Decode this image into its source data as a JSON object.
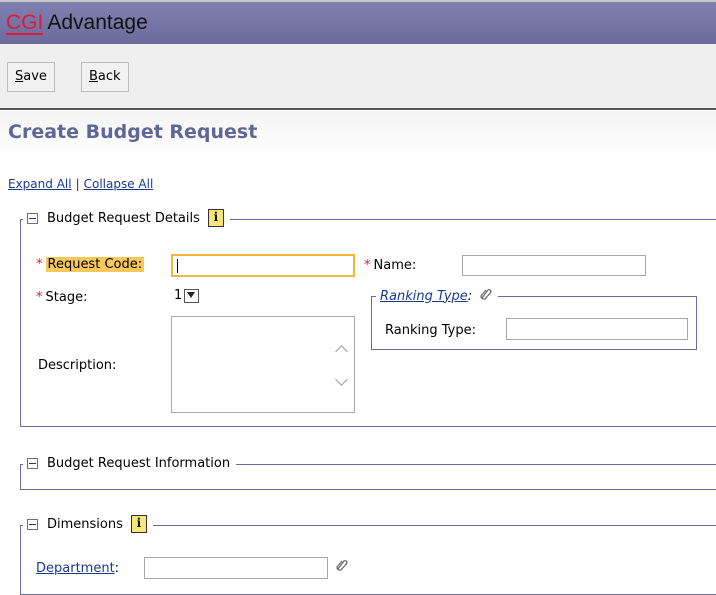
{
  "app": {
    "brand_cgi": "CGI",
    "brand_name": "Advantage"
  },
  "toolbar": {
    "save_label": "Save",
    "save_key": "S",
    "save_rest": "ave",
    "back_label": "Back",
    "back_key": "B",
    "back_rest": "ack"
  },
  "page": {
    "title": "Create Budget Request"
  },
  "links": {
    "expand_all": "Expand All",
    "separator": "|",
    "collapse_all": "Collapse All"
  },
  "sections": {
    "details": {
      "title": "Budget Request Details",
      "request_code": {
        "label": "Request Code:",
        "value": ""
      },
      "name": {
        "label": "Name:",
        "value": ""
      },
      "stage": {
        "label": "Stage:",
        "value": "1"
      },
      "description": {
        "label": "Description:",
        "value": ""
      },
      "ranking_type": {
        "group_label": "Ranking Type",
        "group_colon": ":",
        "label": "Ranking Type:",
        "value": ""
      }
    },
    "information": {
      "title": "Budget Request Information"
    },
    "dimensions": {
      "title": "Dimensions",
      "department": {
        "label": "Department",
        "colon": ":",
        "value": ""
      }
    }
  },
  "required_marker": "*",
  "icons": {
    "info": "info-icon",
    "attach": "paperclip-icon",
    "collapse": "collapse-toggle-icon"
  },
  "colors": {
    "header_bg": "#6b6b9d",
    "brand_red": "#e31937",
    "title": "#5f6796",
    "highlight": "#f8c85a",
    "link": "#1a3a8c"
  }
}
